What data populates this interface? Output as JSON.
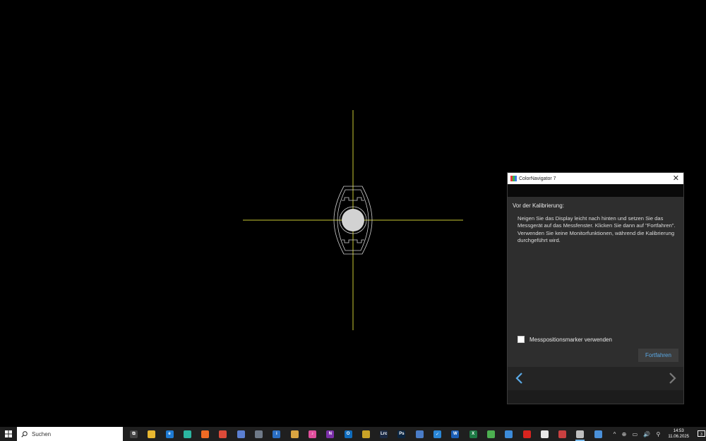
{
  "dialog": {
    "title": "ColorNavigator 7",
    "close_label": "✕",
    "heading": "Vor der Kalibrierung:",
    "instructions": "Neigen Sie das Display leicht nach hinten und setzen Sie das Messgerät auf das Messfenster. Klicken Sie dann auf \"Fortfahren\". Verwenden Sie keine Monitorfunktionen, während die Kalibrierung durchgeführt wird.",
    "checkbox_label": "Messpositionsmarker verwenden",
    "checkbox_checked": false,
    "continue_label": "Fortfahren",
    "accent_color": "#5aa9e6"
  },
  "target": {
    "crosshair_color": "#c8c832",
    "outline_color": "#cfcfcf",
    "spot_color": "#d2d2d2"
  },
  "taskbar": {
    "search_placeholder": "Suchen",
    "time": "14:53",
    "date": "11.06.2025",
    "notification_count": "3",
    "tray_text": "^ ⊕ ▭ 🔊 ⚲",
    "apps": [
      {
        "name": "task-view-icon",
        "glyph": "⧉",
        "color": "#444"
      },
      {
        "name": "file-explorer-icon",
        "glyph": "",
        "color": "#e8b730"
      },
      {
        "name": "edge-legacy-icon",
        "glyph": "e",
        "color": "#1e7bd4"
      },
      {
        "name": "edge-icon",
        "glyph": "",
        "color": "#2bb5a0"
      },
      {
        "name": "firefox-icon",
        "glyph": "",
        "color": "#f06b24"
      },
      {
        "name": "chrome-icon",
        "glyph": "",
        "color": "#dd4b39"
      },
      {
        "name": "network-app-icon",
        "glyph": "",
        "color": "#5b7fd1"
      },
      {
        "name": "lock-app-icon",
        "glyph": "",
        "color": "#6f7a88"
      },
      {
        "name": "info-app-icon",
        "glyph": "i",
        "color": "#2a6fc4"
      },
      {
        "name": "media-app-icon",
        "glyph": "",
        "color": "#d9a441"
      },
      {
        "name": "itunes-icon",
        "glyph": "♪",
        "color": "#e04f9c"
      },
      {
        "name": "onenote-icon",
        "glyph": "N",
        "color": "#7b2fa8"
      },
      {
        "name": "outlook-icon",
        "glyph": "O",
        "color": "#0f6cbd"
      },
      {
        "name": "chrome-canary-icon",
        "glyph": "",
        "color": "#c9a227"
      },
      {
        "name": "lightroom-icon",
        "glyph": "Lrc",
        "color": "#1b2a45"
      },
      {
        "name": "photoshop-icon",
        "glyph": "Ps",
        "color": "#0b2540"
      },
      {
        "name": "calendar-app-icon",
        "glyph": "",
        "color": "#4a7cc7"
      },
      {
        "name": "check-app-icon",
        "glyph": "✓",
        "color": "#2a86d6"
      },
      {
        "name": "word-icon",
        "glyph": "W",
        "color": "#1b5eb6"
      },
      {
        "name": "excel-icon",
        "glyph": "X",
        "color": "#1d7a45"
      },
      {
        "name": "spreadsheet-app-icon",
        "glyph": "",
        "color": "#4caf50"
      },
      {
        "name": "mail-app-icon",
        "glyph": "",
        "color": "#3c8bd9"
      },
      {
        "name": "acrobat-icon",
        "glyph": "",
        "color": "#d9241f"
      },
      {
        "name": "document-app-icon",
        "glyph": "",
        "color": "#e8e8e8"
      },
      {
        "name": "paint-app-icon",
        "glyph": "",
        "color": "#c94040"
      },
      {
        "name": "colornavigator-icon",
        "glyph": "",
        "color": "#bfbfbf"
      },
      {
        "name": "monitor-app-icon",
        "glyph": "",
        "color": "#4a90d9"
      }
    ]
  }
}
